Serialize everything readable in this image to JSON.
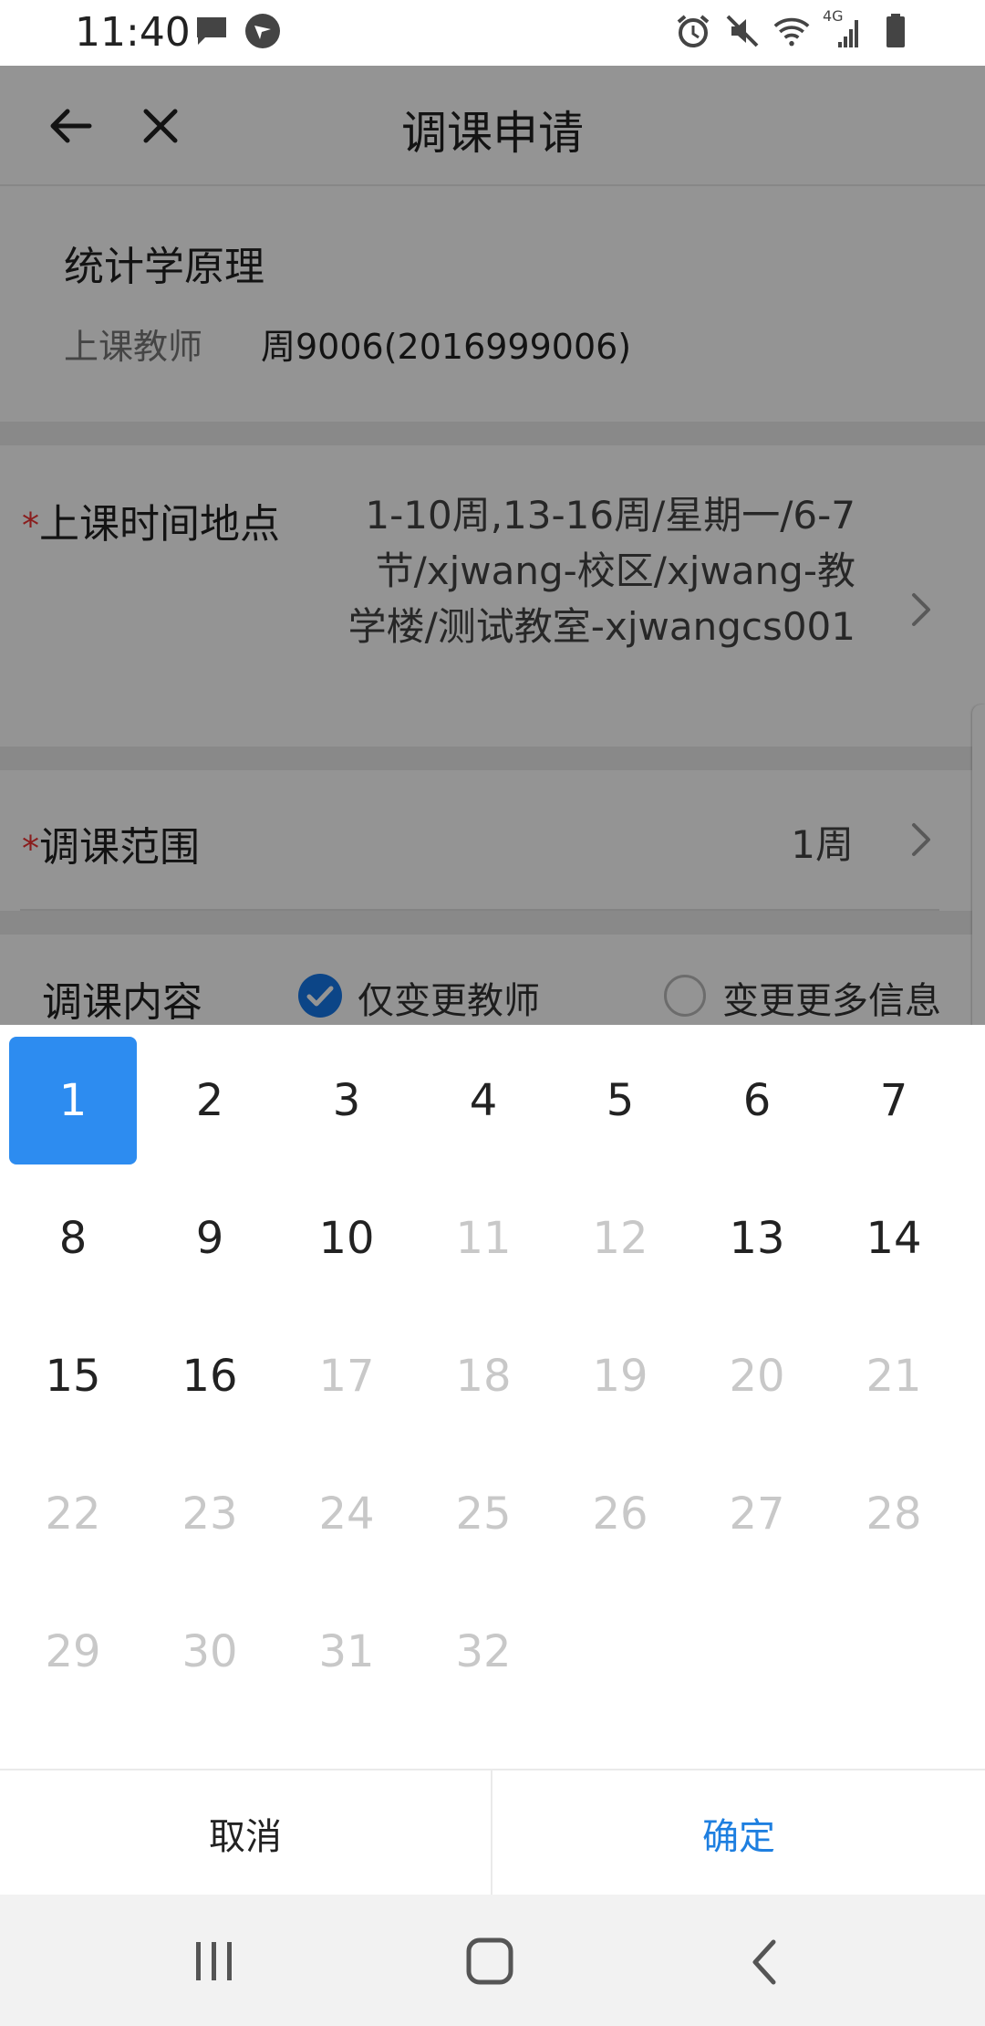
{
  "status_bar": {
    "time": "11:40",
    "left_icons": [
      "message-icon",
      "app-notification-icon"
    ],
    "right_icons": [
      "alarm-icon",
      "mute-icon",
      "wifi-icon",
      "signal-4g-icon",
      "battery-icon"
    ],
    "network_label": "4G"
  },
  "header": {
    "title": "调课申请",
    "back_icon": "arrow-left-icon",
    "close_icon": "close-icon"
  },
  "course": {
    "name": "统计学原理",
    "teacher_label": "上课教师",
    "teacher_value": "周9006(2016999006)"
  },
  "time_place": {
    "required_mark": "*",
    "label": "上课时间地点",
    "value": "1-10周,13-16周/星期一/6-7节/xjwang-校区/xjwang-教学楼/测试教室-xjwangcs001"
  },
  "range": {
    "required_mark": "*",
    "label": "调课范围",
    "value": "1周"
  },
  "content": {
    "label": "调课内容",
    "option_teacher": "仅变更教师",
    "option_more": "变更更多信息",
    "selected": "仅变更教师"
  },
  "week_picker": {
    "weeks": [
      {
        "label": "1",
        "state": "selected"
      },
      {
        "label": "2",
        "state": "enabled"
      },
      {
        "label": "3",
        "state": "enabled"
      },
      {
        "label": "4",
        "state": "enabled"
      },
      {
        "label": "5",
        "state": "enabled"
      },
      {
        "label": "6",
        "state": "enabled"
      },
      {
        "label": "7",
        "state": "enabled"
      },
      {
        "label": "8",
        "state": "enabled"
      },
      {
        "label": "9",
        "state": "enabled"
      },
      {
        "label": "10",
        "state": "enabled"
      },
      {
        "label": "11",
        "state": "disabled"
      },
      {
        "label": "12",
        "state": "disabled"
      },
      {
        "label": "13",
        "state": "enabled"
      },
      {
        "label": "14",
        "state": "enabled"
      },
      {
        "label": "15",
        "state": "enabled"
      },
      {
        "label": "16",
        "state": "enabled"
      },
      {
        "label": "17",
        "state": "disabled"
      },
      {
        "label": "18",
        "state": "disabled"
      },
      {
        "label": "19",
        "state": "disabled"
      },
      {
        "label": "20",
        "state": "disabled"
      },
      {
        "label": "21",
        "state": "disabled"
      },
      {
        "label": "22",
        "state": "disabled"
      },
      {
        "label": "23",
        "state": "disabled"
      },
      {
        "label": "24",
        "state": "disabled"
      },
      {
        "label": "25",
        "state": "disabled"
      },
      {
        "label": "26",
        "state": "disabled"
      },
      {
        "label": "27",
        "state": "disabled"
      },
      {
        "label": "28",
        "state": "disabled"
      },
      {
        "label": "29",
        "state": "disabled"
      },
      {
        "label": "30",
        "state": "disabled"
      },
      {
        "label": "31",
        "state": "disabled"
      },
      {
        "label": "32",
        "state": "disabled"
      }
    ],
    "cancel_label": "取消",
    "confirm_label": "确定"
  },
  "colors": {
    "accent": "#2d8cf0",
    "confirm_text": "#1e7fe0",
    "required": "#e33333",
    "disabled_text": "#c8c8c8"
  },
  "nav_bar": {
    "icons": [
      "recent-apps-icon",
      "home-icon",
      "back-icon"
    ]
  }
}
